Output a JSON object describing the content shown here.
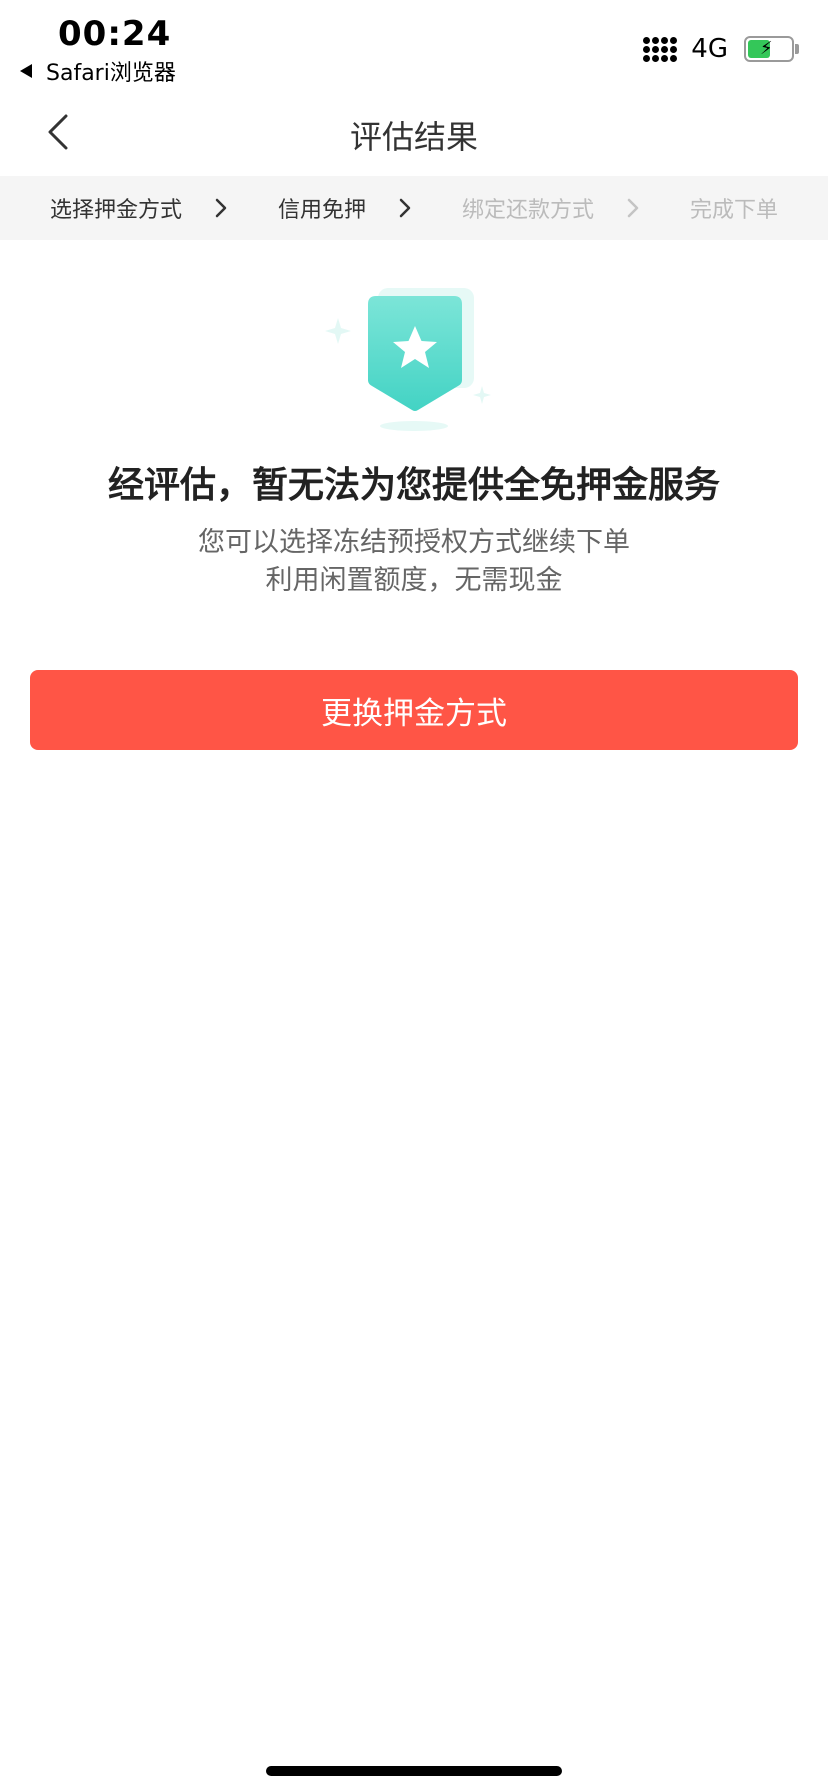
{
  "status_bar": {
    "time": "00:24",
    "back_app": "Safari浏览器",
    "network": "4G",
    "battery_level": 0.55
  },
  "nav": {
    "title": "评估结果"
  },
  "steps": [
    {
      "label": "选择押金方式",
      "active": true
    },
    {
      "label": "信用免押",
      "active": true
    },
    {
      "label": "绑定还款方式",
      "active": false
    },
    {
      "label": "完成下单",
      "active": false
    }
  ],
  "result": {
    "icon": "shield-star-icon",
    "heading": "经评估，暂无法为您提供全免押金服务",
    "line1": "您可以选择冻结预授权方式继续下单",
    "line2": "利用闲置额度，无需现金"
  },
  "actions": {
    "change_deposit_label": "更换押金方式"
  },
  "colors": {
    "primary": "#ff5546",
    "accent_teal": "#4fd6c6",
    "step_bar_bg": "#f5f5f5"
  }
}
